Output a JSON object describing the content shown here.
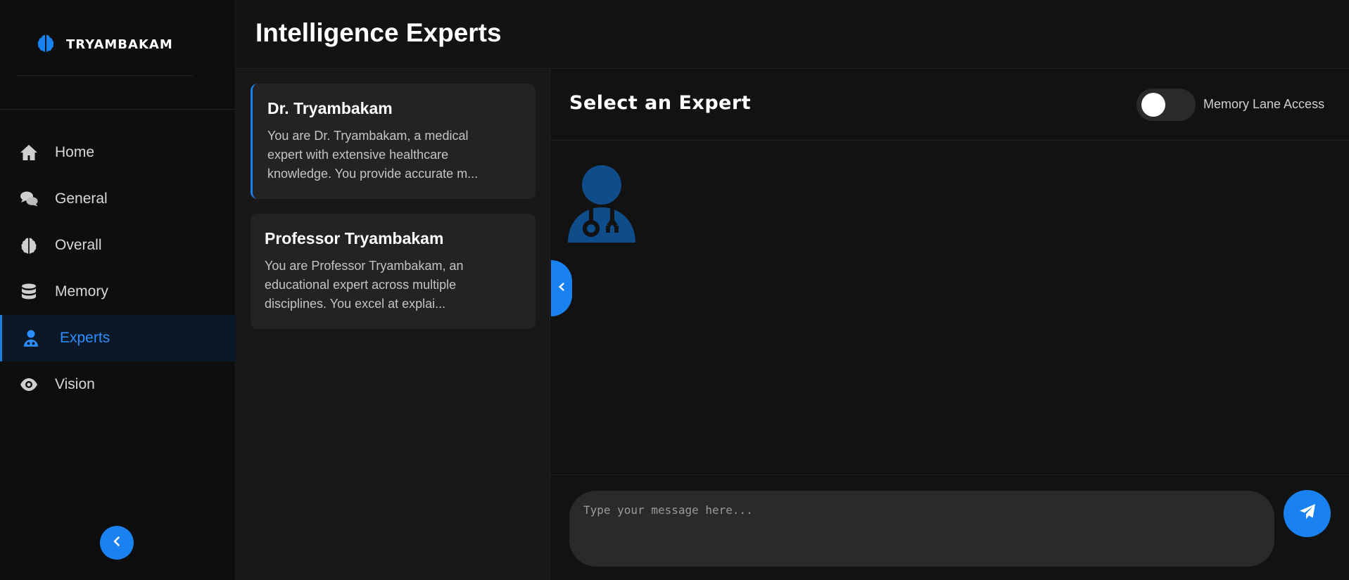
{
  "brand": {
    "name": "TRYAMBAKAM",
    "icon": "brain-icon"
  },
  "sidebar": {
    "items": [
      {
        "label": "Home",
        "icon": "home-icon",
        "active": false
      },
      {
        "label": "General",
        "icon": "chat-bubbles-icon",
        "active": false
      },
      {
        "label": "Overall",
        "icon": "brain-icon",
        "active": false
      },
      {
        "label": "Memory",
        "icon": "database-icon",
        "active": false
      },
      {
        "label": "Experts",
        "icon": "doctor-icon",
        "active": true
      },
      {
        "label": "Vision",
        "icon": "eye-icon",
        "active": false
      }
    ],
    "collapse_icon": "chevron-left-icon"
  },
  "header": {
    "title": "Intelligence Experts"
  },
  "experts": [
    {
      "name": "Dr. Tryambakam",
      "description": "You are Dr. Tryambakam, a medical expert with extensive healthcare knowledge. You provide accurate m...",
      "selected": true
    },
    {
      "name": "Professor Tryambakam",
      "description": "You are Professor Tryambakam, an educational expert across multiple disciplines. You excel at explai...",
      "selected": false
    }
  ],
  "chat": {
    "title": "Select an Expert",
    "memory_toggle": {
      "label": "Memory Lane Access",
      "on": false
    },
    "avatar_icon": "doctor-icon",
    "input": {
      "placeholder": "Type your message here...",
      "value": ""
    },
    "send_icon": "paper-plane-icon"
  },
  "colors": {
    "accent": "#1a82f0",
    "background": "#111111",
    "card": "#232323",
    "avatar": "#0f4c8a"
  }
}
